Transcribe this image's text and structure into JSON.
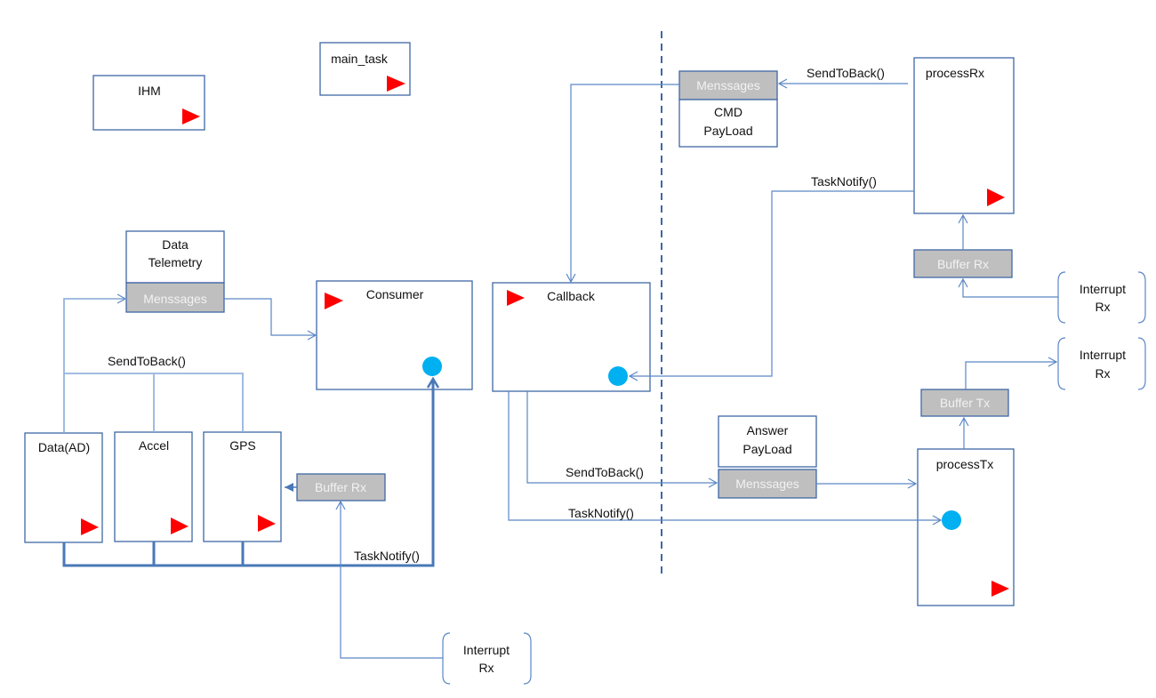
{
  "colors": {
    "line": "#5b87c5",
    "queue": "#bfbfbf",
    "task_marker": "#ff0000",
    "notify_marker": "#00b0f0"
  },
  "tasks": {
    "ihm": "IHM",
    "main_task": "main_task",
    "consumer": "Consumer",
    "data_ad": "Data(AD)",
    "accel": "Accel",
    "gps": "GPS",
    "callback": "Callback",
    "process_rx": "processRx",
    "process_tx": "processTx"
  },
  "queues": {
    "telemetry": {
      "title1": "Data",
      "title2": "Telemetry",
      "label": "Menssages"
    },
    "cmd": {
      "label": "Menssages",
      "line1": "CMD",
      "line2": "PayLoad"
    },
    "answer": {
      "title1": "Answer",
      "title2": "PayLoad",
      "label": "Menssages"
    }
  },
  "buffers": {
    "left_rx": "Buffer Rx",
    "right_rx": "Buffer Rx",
    "right_tx": "Buffer Tx"
  },
  "interrupts": {
    "bottom": {
      "l1": "Interrupt",
      "l2": "Rx"
    },
    "right_rx": {
      "l1": "Interrupt",
      "l2": "Rx"
    },
    "right_tx": {
      "l1": "Interrupt",
      "l2": "Rx"
    }
  },
  "labels": {
    "send_left": "SendToBack()",
    "notify_left": "TaskNotify()",
    "send_rx": "SendToBack()",
    "notify_rx": "TaskNotify()",
    "send_cb": "SendToBack()",
    "notify_cb": "TaskNotify()"
  }
}
